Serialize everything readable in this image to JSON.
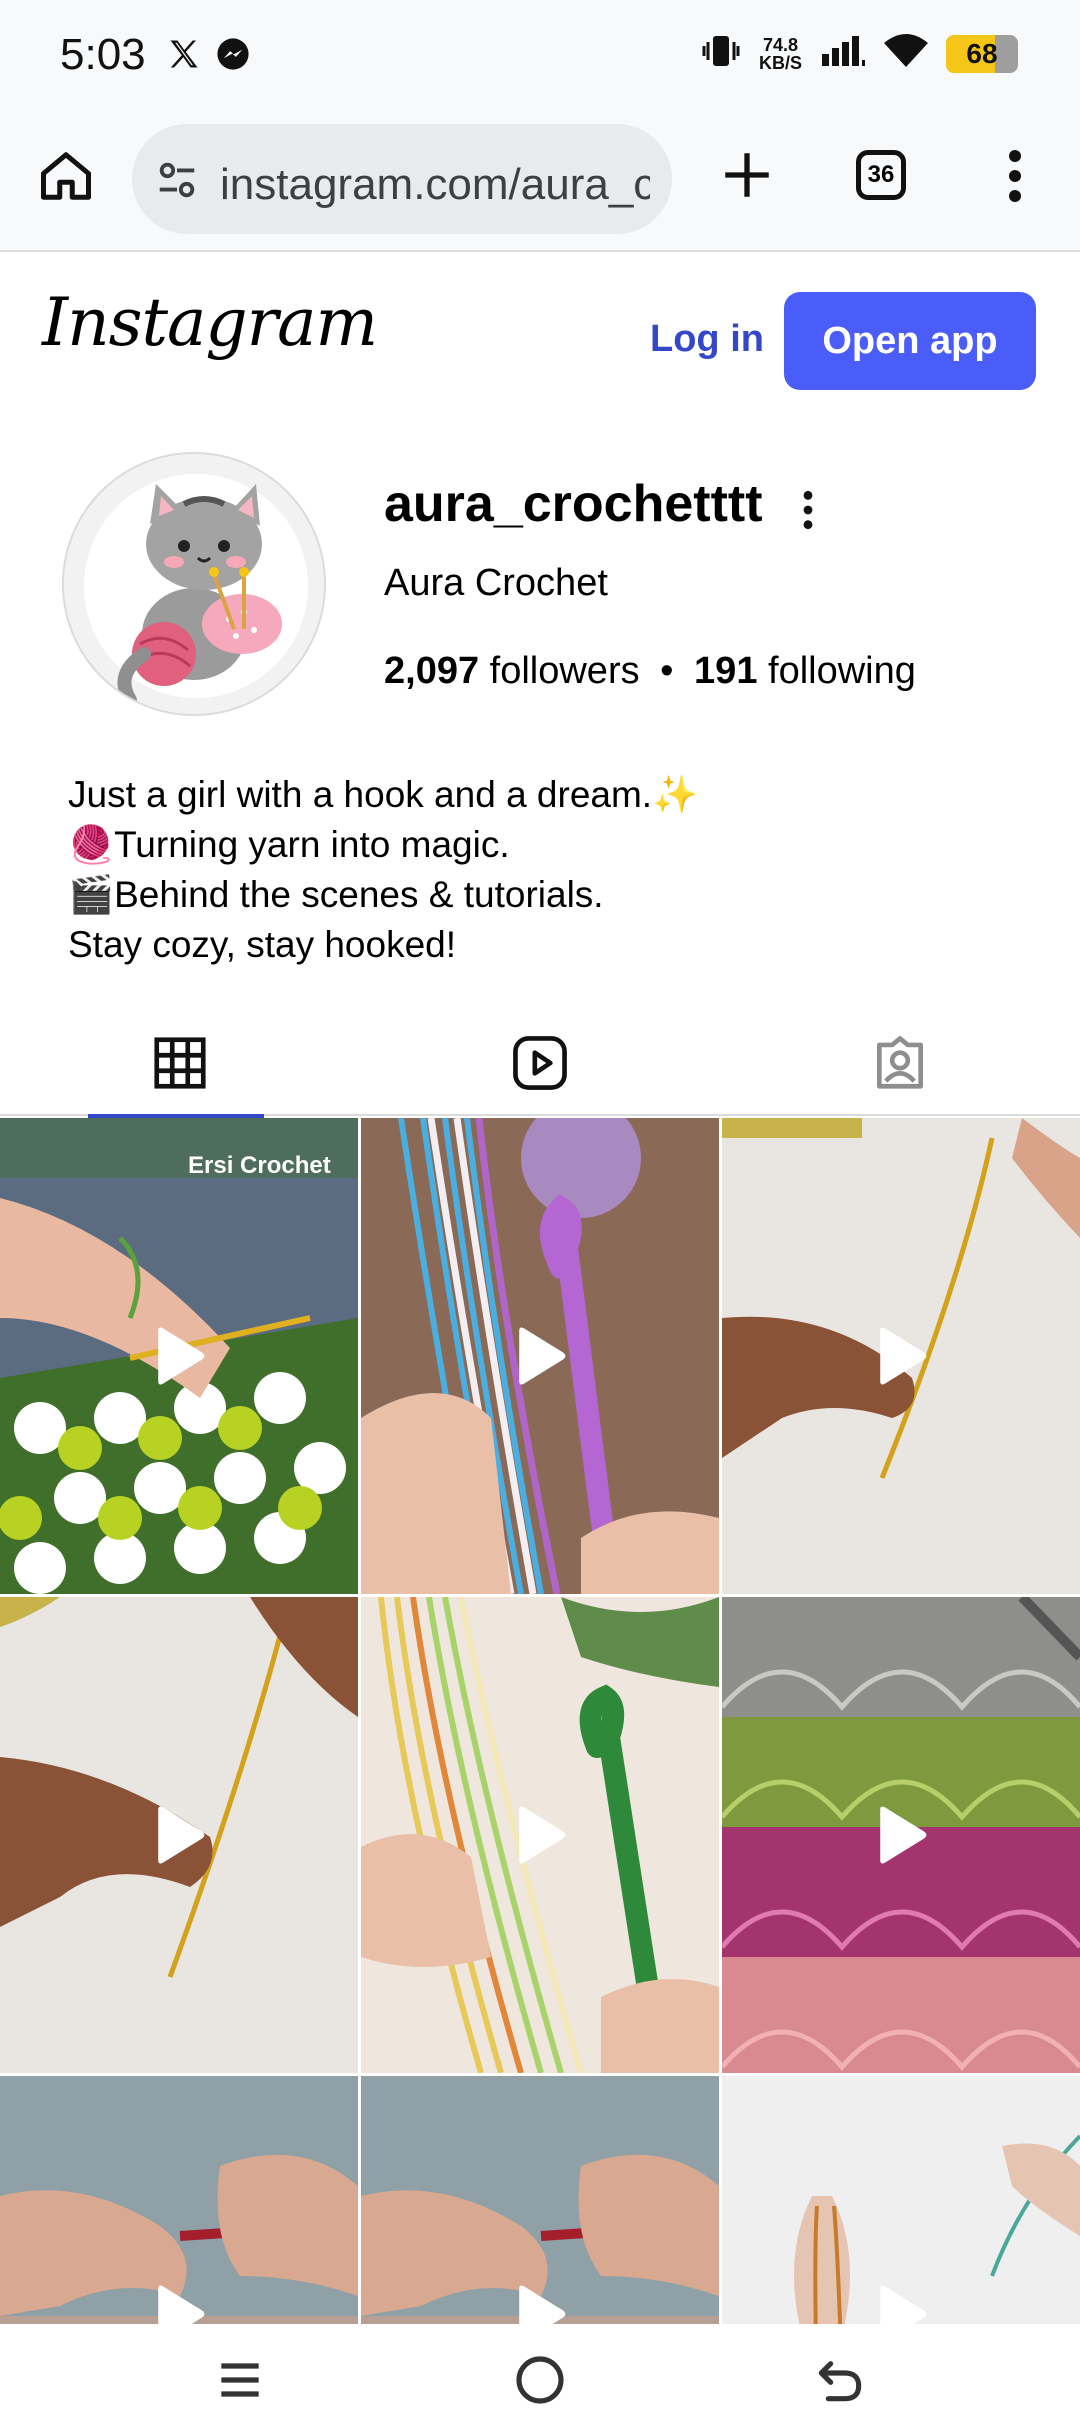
{
  "status_bar": {
    "time": "5:03",
    "net_speed_value": "74.8",
    "net_speed_unit": "KB/S",
    "battery": "68",
    "battery_level": 0.68,
    "left_icons": [
      "x-logo-icon",
      "messenger-icon"
    ],
    "right_icons": [
      "vibrate-icon",
      "signal-icon",
      "wifi-icon",
      "battery-icon"
    ]
  },
  "browser": {
    "url": "instagram.com/aura_crochetttt",
    "tab_count": "36",
    "icons": [
      "home-icon",
      "site-settings-icon",
      "new-tab-icon",
      "tab-switcher-icon",
      "menu-icon"
    ]
  },
  "header": {
    "logo_text": "Instagram",
    "login_label": "Log in",
    "open_app_label": "Open app",
    "accent": "#4a5df9"
  },
  "profile": {
    "username": "aura_crochetttt",
    "full_name": "Aura Crochet",
    "followers_count": "2,097",
    "followers_label": "followers",
    "separator": "•",
    "following_count": "191",
    "following_label": "following",
    "bio": [
      "Just a girl with a hook and a dream.✨",
      "🧶Turning yarn into magic.",
      "🎬Behind the scenes & tutorials.",
      "Stay cozy, stay hooked!"
    ]
  },
  "tabs": [
    {
      "name": "posts",
      "icon": "grid-icon",
      "active": true
    },
    {
      "name": "reels",
      "icon": "reels-icon",
      "active": false
    },
    {
      "name": "tagged",
      "icon": "tagged-icon",
      "active": false
    }
  ],
  "posts": [
    {
      "caption": "Ersi Crochet",
      "type": "reel"
    },
    {
      "caption": "",
      "type": "reel"
    },
    {
      "caption": "",
      "type": "reel"
    },
    {
      "caption": "",
      "type": "reel"
    },
    {
      "caption": "",
      "type": "reel"
    },
    {
      "caption": "",
      "type": "reel"
    },
    {
      "caption": "",
      "type": "reel"
    },
    {
      "caption": "",
      "type": "reel"
    },
    {
      "caption": "",
      "type": "reel"
    }
  ],
  "nav_bar": {
    "icons": [
      "recents-icon",
      "home-circle-icon",
      "back-icon"
    ]
  }
}
